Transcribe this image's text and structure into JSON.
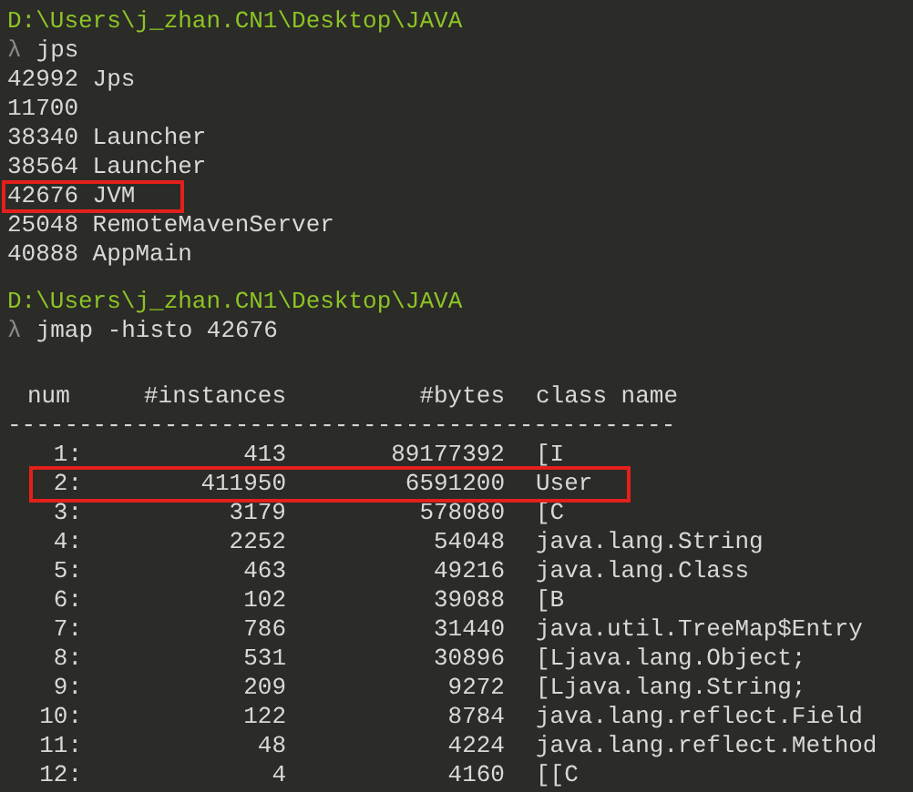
{
  "sessions": [
    {
      "prompt": "D:\\Users\\j_zhan.CN1\\Desktop\\JAVA",
      "symbol": "λ",
      "command": "jps",
      "output": [
        {
          "text": "42992 Jps",
          "highlighted": false
        },
        {
          "text": "11700",
          "highlighted": false
        },
        {
          "text": "38340 Launcher",
          "highlighted": false
        },
        {
          "text": "38564 Launcher",
          "highlighted": false
        },
        {
          "text": "42676 JVM",
          "highlighted": true
        },
        {
          "text": "25048 RemoteMavenServer",
          "highlighted": false
        },
        {
          "text": "40888 AppMain",
          "highlighted": false
        }
      ]
    },
    {
      "prompt": "D:\\Users\\j_zhan.CN1\\Desktop\\JAVA",
      "symbol": "λ",
      "command": "jmap -histo 42676",
      "table": {
        "columns": [
          "num",
          "#instances",
          "#bytes",
          "class name"
        ],
        "separator": "-----------------------------------------------",
        "rows": [
          {
            "num": "1:",
            "instances": "413",
            "bytes": "89177392",
            "class_name": "[I",
            "highlighted": false
          },
          {
            "num": "2:",
            "instances": "411950",
            "bytes": "6591200",
            "class_name": "User",
            "highlighted": true
          },
          {
            "num": "3:",
            "instances": "3179",
            "bytes": "578080",
            "class_name": "[C",
            "highlighted": false
          },
          {
            "num": "4:",
            "instances": "2252",
            "bytes": "54048",
            "class_name": "java.lang.String",
            "highlighted": false
          },
          {
            "num": "5:",
            "instances": "463",
            "bytes": "49216",
            "class_name": "java.lang.Class",
            "highlighted": false
          },
          {
            "num": "6:",
            "instances": "102",
            "bytes": "39088",
            "class_name": "[B",
            "highlighted": false
          },
          {
            "num": "7:",
            "instances": "786",
            "bytes": "31440",
            "class_name": "java.util.TreeMap$Entry",
            "highlighted": false
          },
          {
            "num": "8:",
            "instances": "531",
            "bytes": "30896",
            "class_name": "[Ljava.lang.Object;",
            "highlighted": false
          },
          {
            "num": "9:",
            "instances": "209",
            "bytes": "9272",
            "class_name": "[Ljava.lang.String;",
            "highlighted": false
          },
          {
            "num": "10:",
            "instances": "122",
            "bytes": "8784",
            "class_name": "java.lang.reflect.Field",
            "highlighted": false
          },
          {
            "num": "11:",
            "instances": "48",
            "bytes": "4224",
            "class_name": "java.lang.reflect.Method",
            "highlighted": false
          },
          {
            "num": "12:",
            "instances": "4",
            "bytes": "4160",
            "class_name": "[[C",
            "highlighted": false
          }
        ]
      }
    }
  ]
}
